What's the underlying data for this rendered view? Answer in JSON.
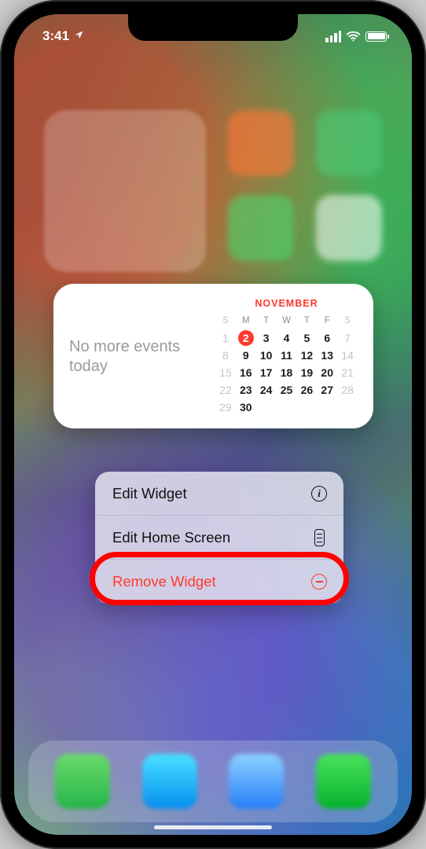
{
  "statusbar": {
    "time": "3:41"
  },
  "widget": {
    "no_events": "No more events today",
    "month": "NOVEMBER",
    "day_headers": [
      "S",
      "M",
      "T",
      "W",
      "T",
      "F",
      "S"
    ],
    "weeks": [
      [
        "1",
        "2",
        "3",
        "4",
        "5",
        "6",
        "7"
      ],
      [
        "8",
        "9",
        "10",
        "11",
        "12",
        "13",
        "14"
      ],
      [
        "15",
        "16",
        "17",
        "18",
        "19",
        "20",
        "21"
      ],
      [
        "22",
        "23",
        "24",
        "25",
        "26",
        "27",
        "28"
      ],
      [
        "29",
        "30",
        "",
        "",
        "",
        "",
        ""
      ]
    ],
    "today": "2"
  },
  "menu": {
    "edit_widget": "Edit Widget",
    "edit_home": "Edit Home Screen",
    "remove": "Remove Widget"
  }
}
